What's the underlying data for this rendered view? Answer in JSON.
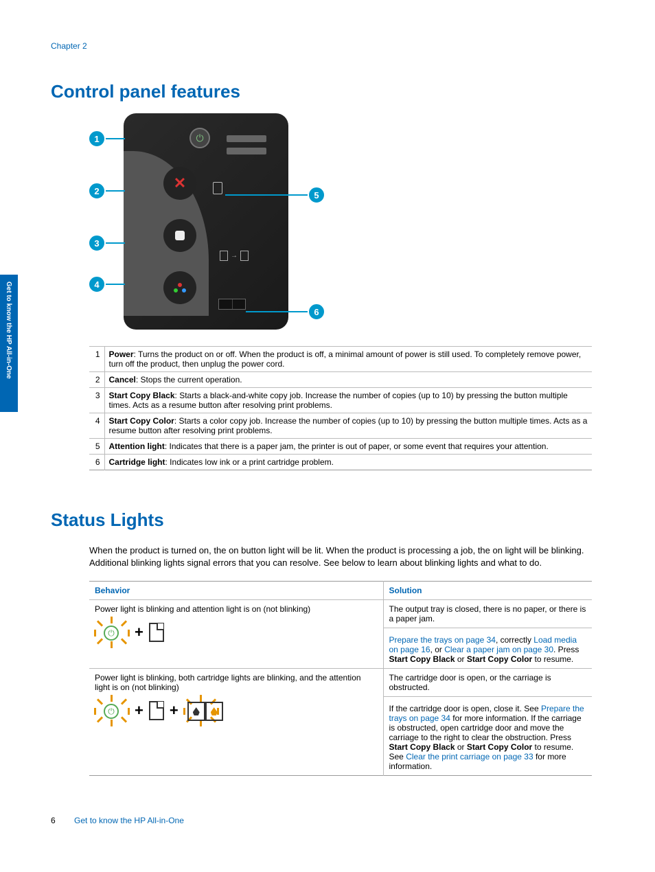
{
  "header": {
    "chapter": "Chapter 2"
  },
  "side_tab": "Get to know the HP All-in-One",
  "h1a": "Control panel features",
  "callouts": {
    "1": "1",
    "2": "2",
    "3": "3",
    "4": "4",
    "5": "5",
    "6": "6"
  },
  "features": [
    {
      "n": "1",
      "label": "Power",
      "desc": ": Turns the product on or off. When the product is off, a minimal amount of power is still used. To completely remove power, turn off the product, then unplug the power cord."
    },
    {
      "n": "2",
      "label": "Cancel",
      "desc": ": Stops the current operation."
    },
    {
      "n": "3",
      "label": "Start Copy Black",
      "desc": ": Starts a black-and-white copy job. Increase the number of copies (up to 10) by pressing the button multiple times. Acts as a resume button after resolving print problems."
    },
    {
      "n": "4",
      "label": "Start Copy Color",
      "desc": ": Starts a color copy job. Increase the number of copies (up to 10) by pressing the button multiple times. Acts as a resume button after resolving print problems."
    },
    {
      "n": "5",
      "label": "Attention light",
      "desc": ": Indicates that there is a paper jam, the printer is out of paper, or some event that requires your attention."
    },
    {
      "n": "6",
      "label": "Cartridge light",
      "desc": ": Indicates low ink or a print cartridge problem."
    }
  ],
  "h1b": "Status Lights",
  "intro": "When the product is turned on, the on button light will be lit. When the product is processing a job, the on light will be blinking. Additional blinking lights signal errors that you can resolve. See below to learn about blinking lights and what to do.",
  "status_table": {
    "headers": {
      "behavior": "Behavior",
      "solution": "Solution"
    },
    "rows": [
      {
        "behavior": "Power light is blinking and attention light is on (not blinking)",
        "sol_top": "The output tray is closed, there is no paper, or there is a paper jam.",
        "links": {
          "prep": "Prepare the trays on page 34",
          "load": "Load media on page 16",
          "jam": "Clear a paper jam on page 30"
        },
        "sol_mid_1": ", correctly ",
        "sol_mid_2": ", or ",
        "sol_tail_1": ". Press ",
        "b1": "Start Copy Black",
        "sol_tail_2": " or ",
        "b2": "Start Copy Color",
        "sol_tail_3": " to resume."
      },
      {
        "behavior": "Power light is blinking, both cartridge lights are blinking, and the attention light is on (not blinking)",
        "sol_top": "The cartridge door is open, or the carriage is obstructed.",
        "pre": "If the cartridge door is open, close it. See ",
        "links": {
          "prep": "Prepare the trays on page 34",
          "carriage": "Clear the print carriage on page 33"
        },
        "mid1": " for more information. If the carriage is obstructed, open cartridge door and move the carriage to the right to clear the obstruction. Press ",
        "b1": "Start Copy Black",
        "mid2": " or ",
        "b2": "Start Copy Color",
        "mid3": " to resume. See ",
        "tail": " for more information."
      }
    ]
  },
  "footer": {
    "page": "6",
    "title": "Get to know the HP All-in-One"
  }
}
